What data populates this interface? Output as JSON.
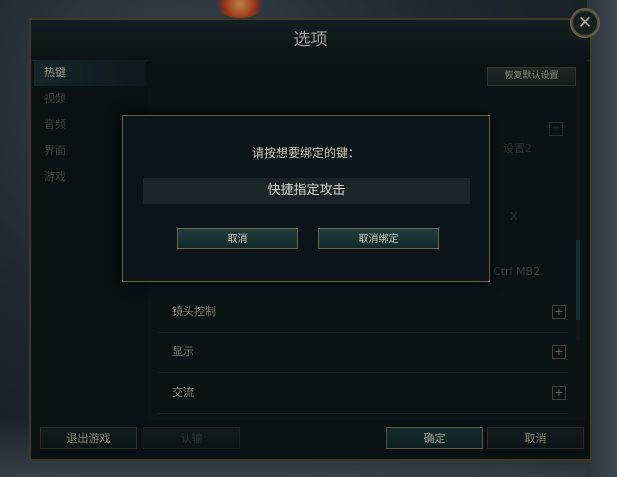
{
  "window": {
    "title": "选项",
    "close_icon": "close-icon"
  },
  "sidebar": {
    "items": [
      {
        "label": "热键",
        "active": true
      },
      {
        "label": "视频"
      },
      {
        "label": "音频"
      },
      {
        "label": "界面"
      },
      {
        "label": "游戏"
      }
    ]
  },
  "content": {
    "restore_label": "恢复默认设置",
    "faded": {
      "col2": "设置2",
      "x": "X",
      "mb2": "Ctrl MB2"
    },
    "sections": [
      {
        "label": "镜头控制"
      },
      {
        "label": "显示"
      },
      {
        "label": "交流"
      }
    ]
  },
  "footer": {
    "exit_label": "退出游戏",
    "surrender_label": "认输",
    "ok_label": "确定",
    "cancel_label": "取消"
  },
  "modal": {
    "prompt": "请按想要绑定的键：",
    "action": "快捷指定攻击",
    "cancel_label": "取消",
    "unbind_label": "取消绑定"
  }
}
